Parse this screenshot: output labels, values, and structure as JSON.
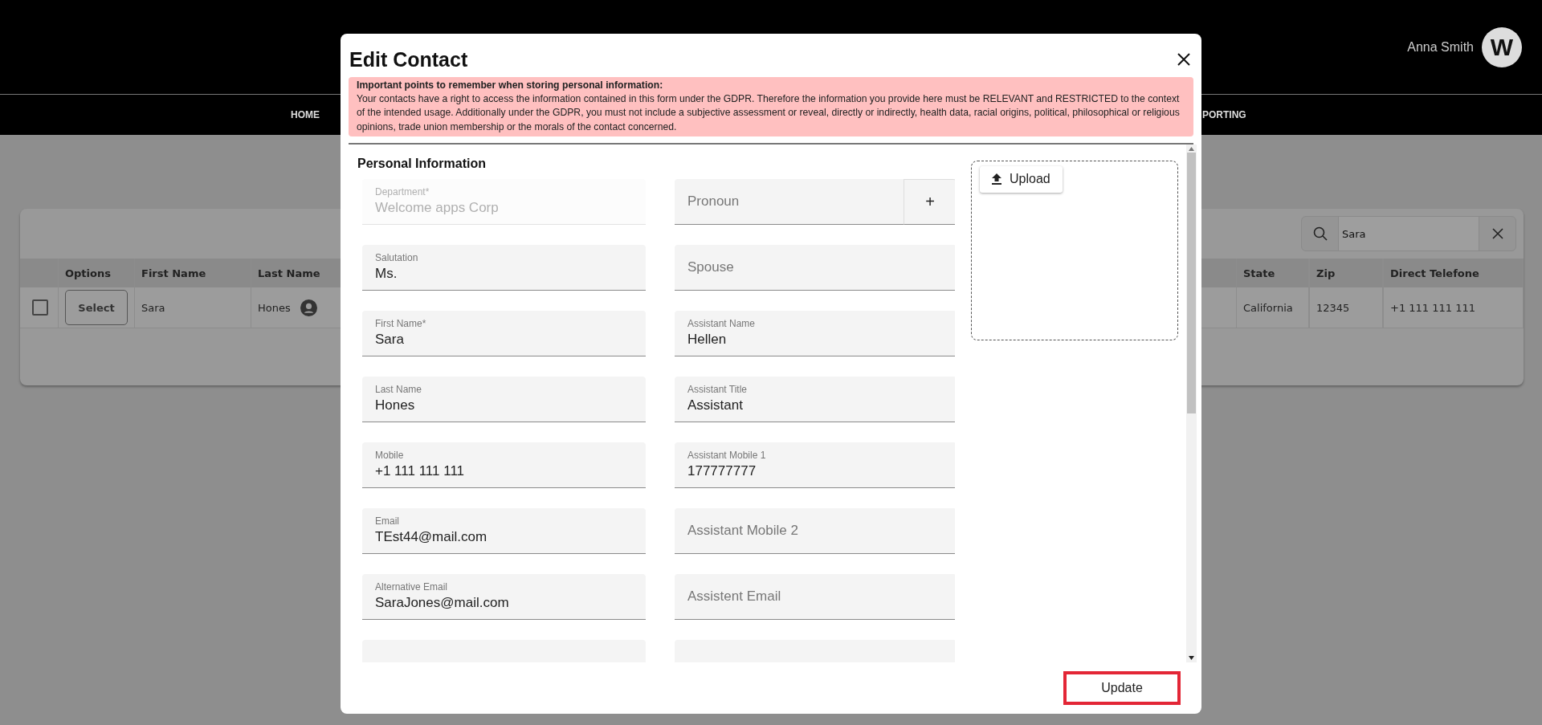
{
  "header": {
    "user_name": "Anna Smith",
    "avatar_letter": "W"
  },
  "nav": [
    {
      "label": "HOME"
    },
    {
      "label": "PORTING"
    }
  ],
  "search": {
    "value": "Sara"
  },
  "table": {
    "columns_left": [
      "Options",
      "First Name",
      "Last Name"
    ],
    "columns_right": [
      "State",
      "Zip",
      "Direct Telefone"
    ],
    "rows": [
      {
        "checked": false,
        "option": "Select",
        "first_name": "Sara",
        "last_name": "Hones",
        "state": "California",
        "zip": "12345",
        "direct_telefone": "+1 111 111 111"
      }
    ]
  },
  "modal": {
    "title": "Edit Contact",
    "alert": {
      "heading": "Important points to remember when storing personal information:",
      "body": "Your contacts have a right to access the information contained in this form under the GDPR. Therefore the information you provide here must be RELEVANT and RESTRICTED to the context of the intended usage. Additionally under the GDPR, you must not include a subjective assessment or reveal, directly or indirectly, health data, racial origins, political, philosophical or religious opinions, trade union membership or the morals of the contact concerned."
    },
    "section": "Personal Information",
    "upload": "Upload",
    "fields_left": [
      {
        "label": "Department*",
        "value": "Welcome apps Corp",
        "disabled": true
      },
      {
        "label": "Salutation",
        "value": "Ms.",
        "disabled": false
      },
      {
        "label": "First Name*",
        "value": "Sara",
        "disabled": false
      },
      {
        "label": "Last Name",
        "value": "Hones",
        "disabled": false
      },
      {
        "label": "Mobile",
        "value": "+1 111 111 111",
        "disabled": false
      },
      {
        "label": "Email",
        "value": "TEst44@mail.com",
        "disabled": false
      },
      {
        "label": "Alternative Email",
        "value": "SaraJones@mail.com",
        "disabled": false
      }
    ],
    "fields_right": [
      {
        "placeholder": "Pronoun",
        "action": "+",
        "disabled": false
      },
      {
        "placeholder": "Spouse",
        "disabled": false
      },
      {
        "label": "Assistant Name",
        "value": "Hellen",
        "disabled": false
      },
      {
        "label": "Assistant Title",
        "value": "Assistant",
        "disabled": false
      },
      {
        "label": "Assistant Mobile 1",
        "value": "177777777",
        "disabled": false
      },
      {
        "placeholder": "Assistant Mobile 2",
        "disabled": false
      },
      {
        "placeholder": "Assistent Email",
        "disabled": false
      }
    ],
    "button": "Update"
  }
}
